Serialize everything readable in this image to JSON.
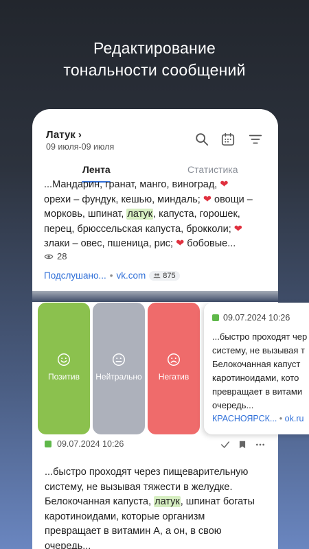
{
  "promo": {
    "title_line1": "Редактирование",
    "title_line2": "тональности сообщений"
  },
  "header": {
    "channel": "Латук",
    "chevron": "›",
    "date_range": "09 июля-09 июля",
    "icons": [
      "search-icon",
      "calendar-icon",
      "filter-icon"
    ]
  },
  "tabs": {
    "feed": "Лента",
    "stats": "Статистика"
  },
  "post1": {
    "line1": "...Мандарин, гранат, манго, виноград, ",
    "line2a": "орехи – фундук, кешью, миндаль; ",
    "line2b": " овощи –",
    "line3a": "морковь, шпинат, ",
    "line3hl": "латук",
    "line3b": ", капуста, горошек,",
    "line4a": "перец, брюссельская капуста, брокколи; ",
    "line5a": "злаки – овес, пшеница, рис; ",
    "line5b": " бобовые...",
    "heart": "❤",
    "views": "28",
    "source": "Подслушано...",
    "sep": "•",
    "domain": "vk.com",
    "badge_count": "875"
  },
  "actions": {
    "positive": "Позитив",
    "neutral": "Нейтрально",
    "negative": "Негатив",
    "positive_face": "☺",
    "neutral_face": "😐",
    "negative_face": "☹",
    "colors": {
      "positive": "#8bc14e",
      "neutral": "#adb1bb",
      "negative": "#ef6b6b"
    }
  },
  "swiped_card": {
    "date": "09.07.2024 10:26",
    "line1": "...быстро проходят чер",
    "line2": "систему, не вызывая т",
    "line3": "Белокочанная капуст",
    "line4": "каротиноидами, кото",
    "line5": "превращает в витами",
    "line6": "очередь...",
    "source": "КРАСНОЯРСК...",
    "sep": "•",
    "domain": "ok.ru"
  },
  "post2": {
    "date": "09.07.2024 10:26",
    "line1": "...быстро проходят через пищеварительную",
    "line2": "систему, не вызывая тяжести в желудке.",
    "line3a": "Белокочанная капуста, ",
    "line3hl": "латук",
    "line3b": ", шпинат богаты",
    "line4": "каротиноидами, которые организм",
    "line5": "превращает в витамин А, а он, в свою",
    "line6": "очередь..."
  }
}
